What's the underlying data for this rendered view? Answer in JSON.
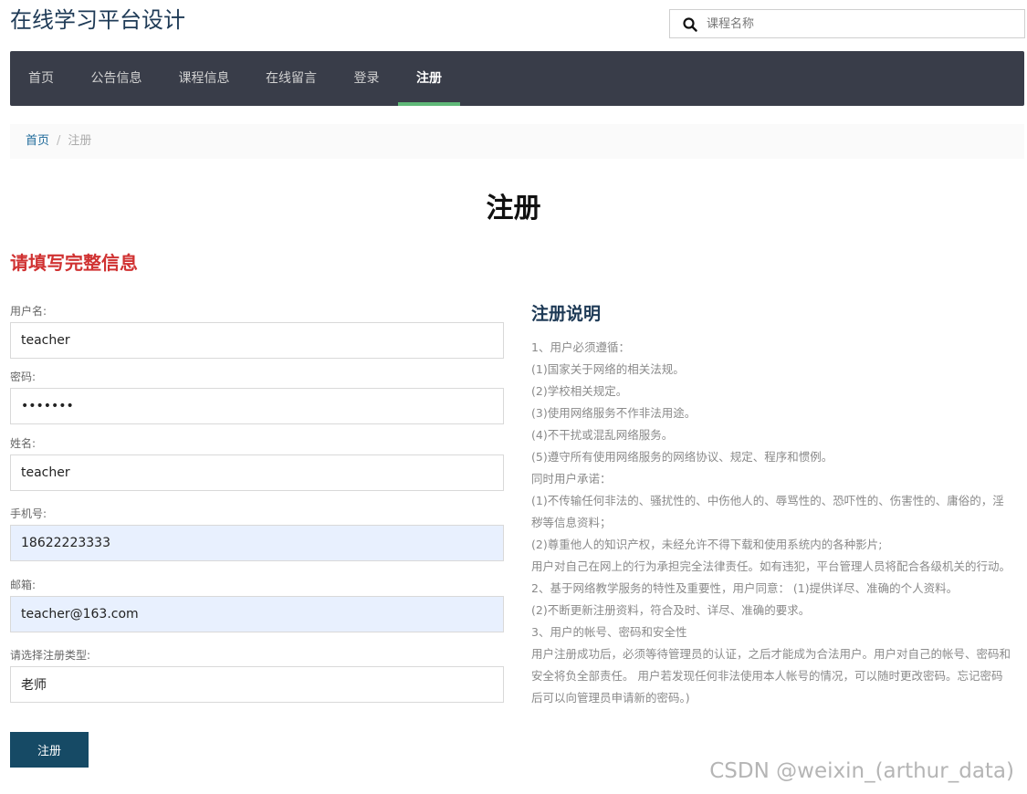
{
  "header": {
    "site_title": "在线学习平台设计",
    "search_placeholder": "课程名称",
    "search_icon": "search-icon"
  },
  "nav": {
    "items": [
      {
        "label": "首页"
      },
      {
        "label": "公告信息"
      },
      {
        "label": "课程信息"
      },
      {
        "label": "在线留言"
      },
      {
        "label": "登录"
      },
      {
        "label": "注册"
      }
    ],
    "active": "注册",
    "active_color": "#5fb878",
    "bg_color": "#393d49"
  },
  "breadcrumb": {
    "home": "首页",
    "separator": "/",
    "current": "注册"
  },
  "page": {
    "heading": "注册"
  },
  "form": {
    "heading": "请填写完整信息",
    "fields": [
      {
        "label": "用户名:",
        "value": "teacher"
      },
      {
        "label": "密码:",
        "value": "•••••••"
      },
      {
        "label": "姓名:",
        "value": "teacher"
      },
      {
        "label": "手机号:",
        "value": "18622223333"
      },
      {
        "label": "邮箱:",
        "value": "teacher@163.com"
      },
      {
        "label": "请选择注册类型:",
        "value": "老师"
      }
    ],
    "submit_label": "注册",
    "heading_color": "#d03232",
    "button_color": "#164a65"
  },
  "notes": {
    "title": "注册说明",
    "lines": [
      "1、用户必须遵循：",
      "(1)国家关于网络的相关法规。",
      "(2)学校相关规定。",
      "(3)使用网络服务不作非法用途。",
      "(4)不干扰或混乱网络服务。",
      "(5)遵守所有使用网络服务的网络协议、规定、程序和惯例。",
      "同时用户承诺：",
      "(1)不传输任何非法的、骚扰性的、中伤他人的、辱骂性的、恐吓性的、伤害性的、庸俗的，淫秽等信息资料；",
      "(2)尊重他人的知识产权，未经允许不得下载和使用系统内的各种影片;",
      "用户对自己在网上的行为承担完全法律责任。如有违犯，平台管理人员将配合各级机关的行动。",
      "2、基于网络教学服务的特性及重要性，用户同意： (1)提供详尽、准确的个人资料。",
      "(2)不断更新注册资料，符合及时、详尽、准确的要求。",
      "3、用户的帐号、密码和安全性",
      "用户注册成功后，必须等待管理员的认证，之后才能成为合法用户。用户对自己的帐号、密码和安全将负全部责任。 用户若发现任何非法使用本人帐号的情况，可以随时更改密码。忘记密码后可以向管理员申请新的密码。)"
    ]
  },
  "watermark": "CSDN @weixin_(arthur_data)"
}
